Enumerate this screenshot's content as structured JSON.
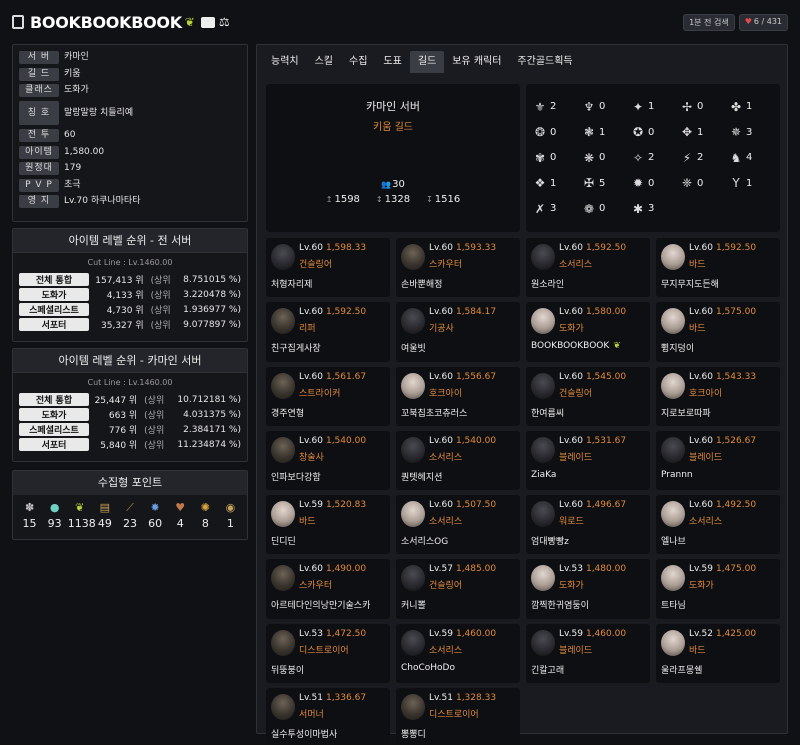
{
  "header": {
    "name": "BOOKBOOKBOOK",
    "recent_label": "1분 전 검색",
    "likes": "6 / 431"
  },
  "info": [
    {
      "label": "서 버",
      "value": "카마인"
    },
    {
      "label": "길 드",
      "value": "키움"
    },
    {
      "label": "클래스",
      "value": "도화가"
    },
    {
      "label": "칭 호",
      "value": "말랑말랑 치들리예",
      "tall": true
    },
    {
      "label": "전 투",
      "value": "60"
    },
    {
      "label": "아이템",
      "value": "1,580.00"
    },
    {
      "label": "원정대",
      "value": "179"
    },
    {
      "label": "P V P",
      "value": "초극"
    },
    {
      "label": "영 지",
      "value": "Lv.70 하쿠나마타타"
    }
  ],
  "rank_all": {
    "title": "아이템 레벨 순위 - 전 서버",
    "cutline": "Cut Line : Lv.1460.00",
    "rows": [
      {
        "k": "전체 통합",
        "n": "157,413 위",
        "s": "(상위",
        "p": "8.751015 %)"
      },
      {
        "k": "도화가",
        "n": "4,133 위",
        "s": "(상위",
        "p": "3.220478 %)"
      },
      {
        "k": "스페셜리스트",
        "n": "4,730 위",
        "s": "(상위",
        "p": "1.936977 %)"
      },
      {
        "k": "서포터",
        "n": "35,327 위",
        "s": "(상위",
        "p": "9.077897 %)"
      }
    ]
  },
  "rank_server": {
    "title": "아이템 레벨 순위 - 카마인 서버",
    "cutline": "Cut Line : Lv.1460.00",
    "rows": [
      {
        "k": "전체 통합",
        "n": "25,447 위",
        "s": "(상위",
        "p": "10.712181 %)"
      },
      {
        "k": "도화가",
        "n": "663 위",
        "s": "(상위",
        "p": "4.031375 %)"
      },
      {
        "k": "스페셜리스트",
        "n": "776 위",
        "s": "(상위",
        "p": "2.384171 %)"
      },
      {
        "k": "서포터",
        "n": "5,840 위",
        "s": "(상위",
        "p": "11.234874 %)"
      }
    ]
  },
  "collect": {
    "title": "수집형 포인트",
    "items": [
      {
        "icon": "mokoko-seed-icon",
        "glyph": "✽",
        "color": "#c9c9c9",
        "count": "15"
      },
      {
        "icon": "island-heart-icon",
        "glyph": "●",
        "color": "#6fd0c4",
        "count": "93"
      },
      {
        "icon": "mokoko-icon",
        "glyph": "❦",
        "color": "#b7d335",
        "count": "1138"
      },
      {
        "icon": "art-icon",
        "glyph": "▤",
        "color": "#c9a35a",
        "count": "49"
      },
      {
        "icon": "voyage-icon",
        "glyph": "⟋",
        "color": "#c98f3a",
        "count": "23"
      },
      {
        "icon": "star-icon",
        "glyph": "✸",
        "color": "#6b9be0",
        "count": "60"
      },
      {
        "icon": "giant-heart-icon",
        "glyph": "♥",
        "color": "#c07a4a",
        "count": "4"
      },
      {
        "icon": "world-tree-icon",
        "glyph": "✺",
        "color": "#d8a640",
        "count": "8"
      },
      {
        "icon": "orpheus-icon",
        "glyph": "◉",
        "color": "#c9a35a",
        "count": "1"
      }
    ]
  },
  "tabs": [
    "능력치",
    "스킬",
    "수집",
    "도표",
    "길드",
    "보유 캐릭터",
    "주간골드획득"
  ],
  "active_tab": 4,
  "guild": {
    "server": "카마인 서버",
    "guild": "키움 길드",
    "members": "30",
    "stats": [
      "1598",
      "1328",
      "1516"
    ]
  },
  "class_counts": [
    {
      "icon": "warlord-icon",
      "glyph": "⚜",
      "count": "2"
    },
    {
      "icon": "berserker-icon",
      "glyph": "♆",
      "count": "0"
    },
    {
      "icon": "destroyer-icon",
      "glyph": "✦",
      "count": "1"
    },
    {
      "icon": "gunlancer-icon",
      "glyph": "✢",
      "count": "0"
    },
    {
      "icon": "slayer-icon",
      "glyph": "✤",
      "count": "1"
    },
    {
      "icon": "bard-icon",
      "glyph": "❂",
      "count": "0"
    },
    {
      "icon": "sorceress-icon",
      "glyph": "❃",
      "count": "1"
    },
    {
      "icon": "summoner-icon",
      "glyph": "✪",
      "count": "0"
    },
    {
      "icon": "arcana-icon",
      "glyph": "✥",
      "count": "1"
    },
    {
      "icon": "paladin-icon",
      "glyph": "✵",
      "count": "3"
    },
    {
      "icon": "wardancer-icon",
      "glyph": "✾",
      "count": "0"
    },
    {
      "icon": "scrapper-icon",
      "glyph": "❋",
      "count": "0"
    },
    {
      "icon": "soulfist-icon",
      "glyph": "✧",
      "count": "2"
    },
    {
      "icon": "striker-icon",
      "glyph": "⚡",
      "count": "2"
    },
    {
      "icon": "glaivier-icon",
      "glyph": "♞",
      "count": "4"
    },
    {
      "icon": "deathblade-icon",
      "glyph": "❖",
      "count": "1"
    },
    {
      "icon": "shadowhunter-icon",
      "glyph": "✠",
      "count": "5"
    },
    {
      "icon": "reaper-icon",
      "glyph": "✹",
      "count": "0"
    },
    {
      "icon": "sharpshooter-icon",
      "glyph": "❈",
      "count": "0"
    },
    {
      "icon": "deadeye-icon",
      "glyph": "Υ",
      "count": "1"
    },
    {
      "icon": "artillerist-icon",
      "glyph": "✗",
      "count": "3"
    },
    {
      "icon": "machinist-icon",
      "glyph": "❁",
      "count": "0"
    },
    {
      "icon": "gunslinger-icon",
      "glyph": "✱",
      "count": "3"
    }
  ],
  "members": [
    {
      "lv": "Lv.60",
      "il": "1,598.33",
      "cls": "건슬링어",
      "name": "처형자리제",
      "av": "dark"
    },
    {
      "lv": "Lv.60",
      "il": "1,593.33",
      "cls": "스카우터",
      "name": "손바뿐해정",
      "av": "normal"
    },
    {
      "lv": "Lv.60",
      "il": "1,592.50",
      "cls": "소서리스",
      "name": "원소라인",
      "av": "dark"
    },
    {
      "lv": "Lv.60",
      "il": "1,592.50",
      "cls": "바드",
      "name": "무지무지도든해",
      "av": "light"
    },
    {
      "lv": "Lv.60",
      "il": "1,592.50",
      "cls": "리퍼",
      "name": "친구집게사장",
      "av": "normal"
    },
    {
      "lv": "Lv.60",
      "il": "1,584.17",
      "cls": "기공사",
      "name": "여울빗",
      "av": "dark"
    },
    {
      "lv": "Lv.60",
      "il": "1,580.00",
      "cls": "도화가",
      "name": "BOOKBOOKBOOK",
      "av": "light",
      "leaf": true
    },
    {
      "lv": "Lv.60",
      "il": "1,575.00",
      "cls": "바드",
      "name": "쀵지덩이",
      "av": "light"
    },
    {
      "lv": "Lv.60",
      "il": "1,561.67",
      "cls": "스트라이커",
      "name": "경주연형",
      "av": "normal"
    },
    {
      "lv": "Lv.60",
      "il": "1,556.67",
      "cls": "호크아이",
      "name": "꼬북칩초코츄러스",
      "av": "light"
    },
    {
      "lv": "Lv.60",
      "il": "1,545.00",
      "cls": "건슬링어",
      "name": "한여름씨",
      "av": "dark"
    },
    {
      "lv": "Lv.60",
      "il": "1,543.33",
      "cls": "호크아이",
      "name": "지로보로따파",
      "av": "light"
    },
    {
      "lv": "Lv.60",
      "il": "1,540.00",
      "cls": "창술사",
      "name": "인파보다강함",
      "av": "normal"
    },
    {
      "lv": "Lv.60",
      "il": "1,540.00",
      "cls": "소서리스",
      "name": "퀀텟헤지션",
      "av": "dark"
    },
    {
      "lv": "Lv.60",
      "il": "1,531.67",
      "cls": "블레이드",
      "name": "ZiaKa",
      "av": "dark"
    },
    {
      "lv": "Lv.60",
      "il": "1,526.67",
      "cls": "블레이드",
      "name": "Prannn",
      "av": "dark"
    },
    {
      "lv": "Lv.59",
      "il": "1,520.83",
      "cls": "바드",
      "name": "딘디딘",
      "av": "light"
    },
    {
      "lv": "Lv.60",
      "il": "1,507.50",
      "cls": "소서리스",
      "name": "소서리스OG",
      "av": "light"
    },
    {
      "lv": "Lv.60",
      "il": "1,496.67",
      "cls": "워로드",
      "name": "엄대빵빵z",
      "av": "dark"
    },
    {
      "lv": "Lv.60",
      "il": "1,492.50",
      "cls": "소서리스",
      "name": "엘나브",
      "av": "light"
    },
    {
      "lv": "Lv.60",
      "il": "1,490.00",
      "cls": "스카우터",
      "name": "아르테다인의낭만기술스카",
      "av": "normal"
    },
    {
      "lv": "Lv.57",
      "il": "1,485.00",
      "cls": "건슬링어",
      "name": "커니뽈",
      "av": "dark"
    },
    {
      "lv": "Lv.53",
      "il": "1,480.00",
      "cls": "도화가",
      "name": "깜찍한귀염둥이",
      "av": "light"
    },
    {
      "lv": "Lv.59",
      "il": "1,475.00",
      "cls": "도화가",
      "name": "트타님",
      "av": "light"
    },
    {
      "lv": "Lv.53",
      "il": "1,472.50",
      "cls": "디스트로이어",
      "name": "뒤뚱붕이",
      "av": "normal"
    },
    {
      "lv": "Lv.59",
      "il": "1,460.00",
      "cls": "소서리스",
      "name": "ChoCoHoDo",
      "av": "dark"
    },
    {
      "lv": "Lv.59",
      "il": "1,460.00",
      "cls": "블레이드",
      "name": "긴칼고래",
      "av": "dark"
    },
    {
      "lv": "Lv.52",
      "il": "1,425.00",
      "cls": "바드",
      "name": "울라프몽쉘",
      "av": "light"
    },
    {
      "lv": "Lv.51",
      "il": "1,336.67",
      "cls": "서머너",
      "name": "실수투성이마법사",
      "av": "normal"
    },
    {
      "lv": "Lv.51",
      "il": "1,328.33",
      "cls": "디스트로이어",
      "name": "뽕뽕디",
      "av": "normal"
    }
  ]
}
